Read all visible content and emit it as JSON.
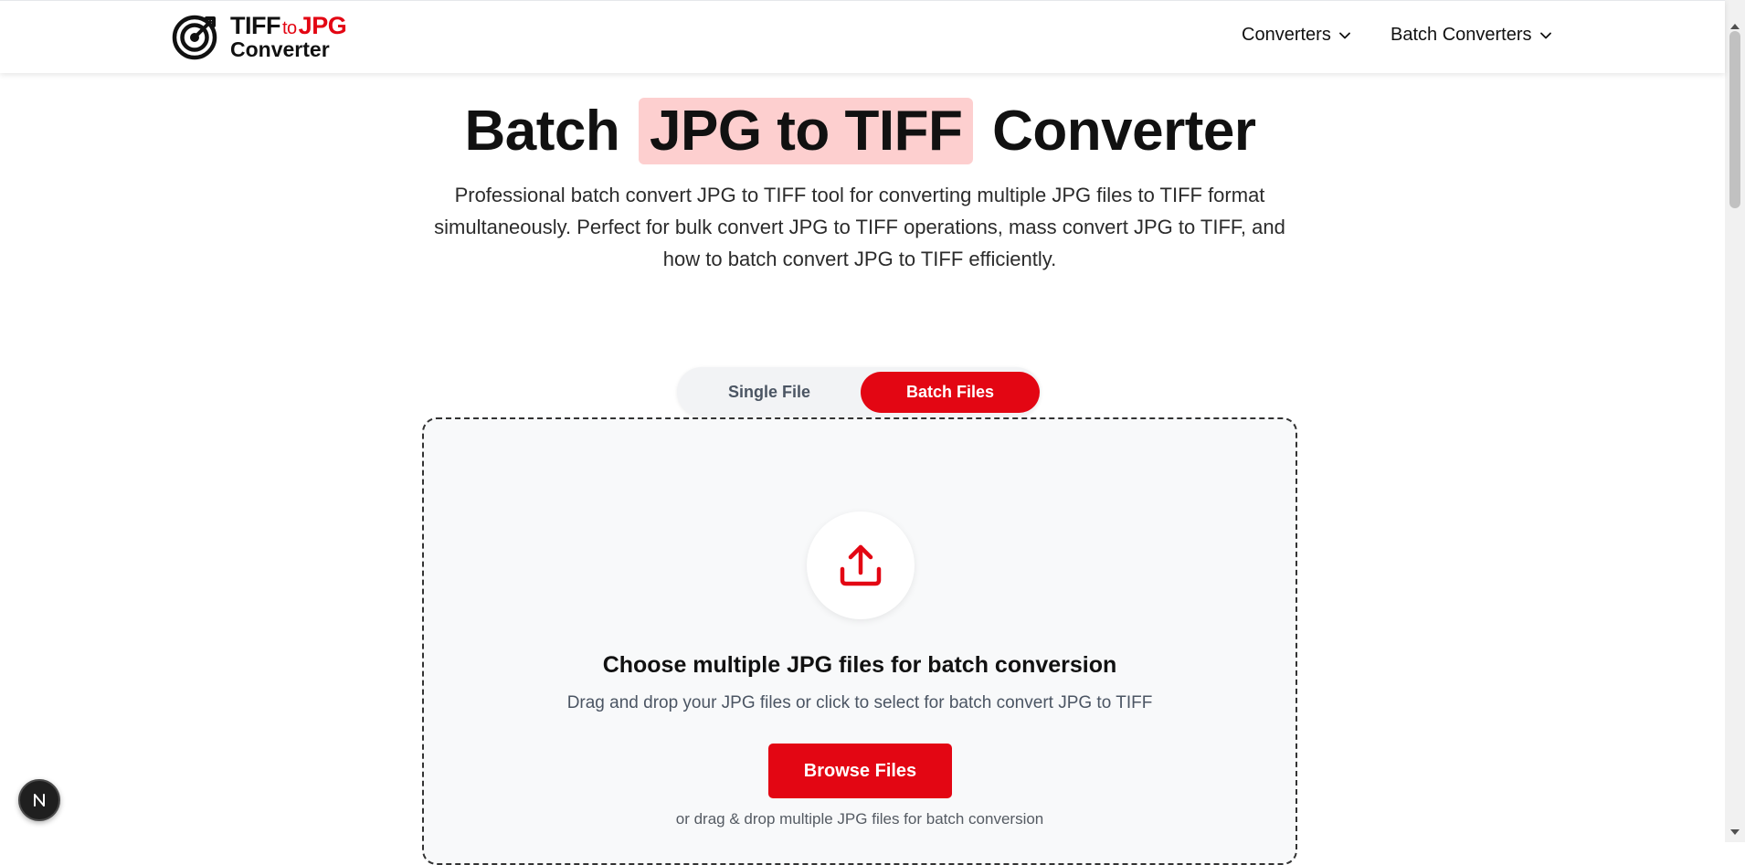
{
  "header": {
    "logo": {
      "line1_tiff": "TIFF",
      "line1_to": "to",
      "line1_jpg": "JPG",
      "line2": "Converter"
    },
    "nav": [
      {
        "label": "Converters"
      },
      {
        "label": "Batch Converters"
      }
    ]
  },
  "hero": {
    "title_before": "Batch",
    "title_highlight": "JPG to TIFF",
    "title_after": "Converter",
    "description": "Professional batch convert JPG to TIFF tool for converting multiple JPG files to TIFF format simultaneously. Perfect for bulk convert JPG to TIFF operations, mass convert JPG to TIFF, and how to batch convert JPG to TIFF efficiently."
  },
  "tabs": [
    {
      "label": "Single File",
      "active": false
    },
    {
      "label": "Batch Files",
      "active": true
    }
  ],
  "dropzone": {
    "title": "Choose multiple JPG files for batch conversion",
    "subtitle": "Drag and drop your JPG files or click to select for batch convert JPG to TIFF",
    "browse_label": "Browse Files",
    "hint": "or drag & drop multiple JPG files for batch conversion"
  },
  "colors": {
    "accent": "#e30613",
    "highlight": "#fdcfcf",
    "dropzone_bg": "#f8f9fa"
  },
  "icons": [
    "target-logo-icon",
    "chevron-down-icon",
    "upload-icon",
    "nextjs-badge-icon"
  ]
}
